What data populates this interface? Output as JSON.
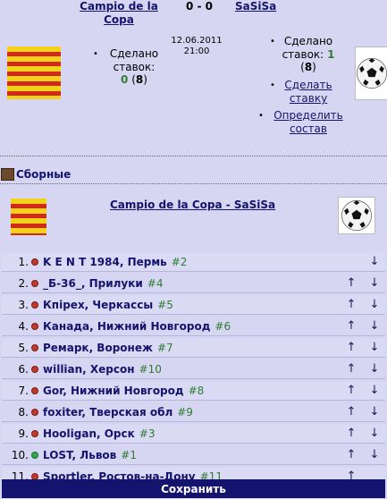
{
  "match": {
    "home_team": "Campio de la Copa",
    "away_team": "SaSiSa",
    "score": "0 - 0",
    "date": "12.06.2011",
    "time": "21:00"
  },
  "home_panel": {
    "bets_label": "Сделано ставок:",
    "bets_value": "0",
    "bets_total": "8"
  },
  "away_panel": {
    "bets_label": "Сделано ставок:",
    "bets_value": "1",
    "bets_total": "8",
    "make_bet_link": "Сделать ставку",
    "set_lineup_link": "Определить состав"
  },
  "section": {
    "title": "Сборные"
  },
  "match_title": "Campio de la Copa - SaSiSa",
  "lineup": [
    {
      "num": "1.",
      "name": "K E N T 1984, Пермь",
      "rank": "#2",
      "dot": "red",
      "up": false,
      "down": true
    },
    {
      "num": "2.",
      "name": "_Б-36_, Прилуки",
      "rank": "#4",
      "dot": "red",
      "up": true,
      "down": true
    },
    {
      "num": "3.",
      "name": "Кпірех, Черкассы",
      "rank": "#5",
      "dot": "red",
      "up": true,
      "down": true
    },
    {
      "num": "4.",
      "name": "Канада, Нижний Новгород",
      "rank": "#6",
      "dot": "red",
      "up": true,
      "down": true
    },
    {
      "num": "5.",
      "name": "Ремарк, Воронеж",
      "rank": "#7",
      "dot": "red",
      "up": true,
      "down": true
    },
    {
      "num": "6.",
      "name": "willian, Херсон",
      "rank": "#10",
      "dot": "red",
      "up": true,
      "down": true
    },
    {
      "num": "7.",
      "name": "Gor, Нижний Новгород",
      "rank": "#8",
      "dot": "red",
      "up": true,
      "down": true
    },
    {
      "num": "8.",
      "name": "foxiter, Тверская обл",
      "rank": "#9",
      "dot": "red",
      "up": true,
      "down": true
    },
    {
      "num": "9.",
      "name": "Hooligan, Орск",
      "rank": "#3",
      "dot": "red",
      "up": true,
      "down": true
    },
    {
      "num": "10.",
      "name": "LOST, Львов",
      "rank": "#1",
      "dot": "green",
      "up": true,
      "down": true
    },
    {
      "num": "11.",
      "name": "Sportler, Ростов-на-Дону",
      "rank": "#11",
      "dot": "red",
      "up": true,
      "down": false
    }
  ],
  "save_button": "Сохранить",
  "icons": {
    "home_flag": "catalan-flag-icon",
    "away_logo": "soccer-ball-icon",
    "section_icon": "national-teams-icon",
    "bullet": "bullet-icon",
    "status_dot": "status-dot-icon",
    "move_up": "arrow-up-icon",
    "move_down": "arrow-down-icon"
  },
  "colors": {
    "background": "#d6d6f2",
    "link": "#14146e",
    "rank": "#2e7d32",
    "dot_red": "#c0392b",
    "dot_green": "#2ea84a",
    "save_bar": "#14146e"
  }
}
